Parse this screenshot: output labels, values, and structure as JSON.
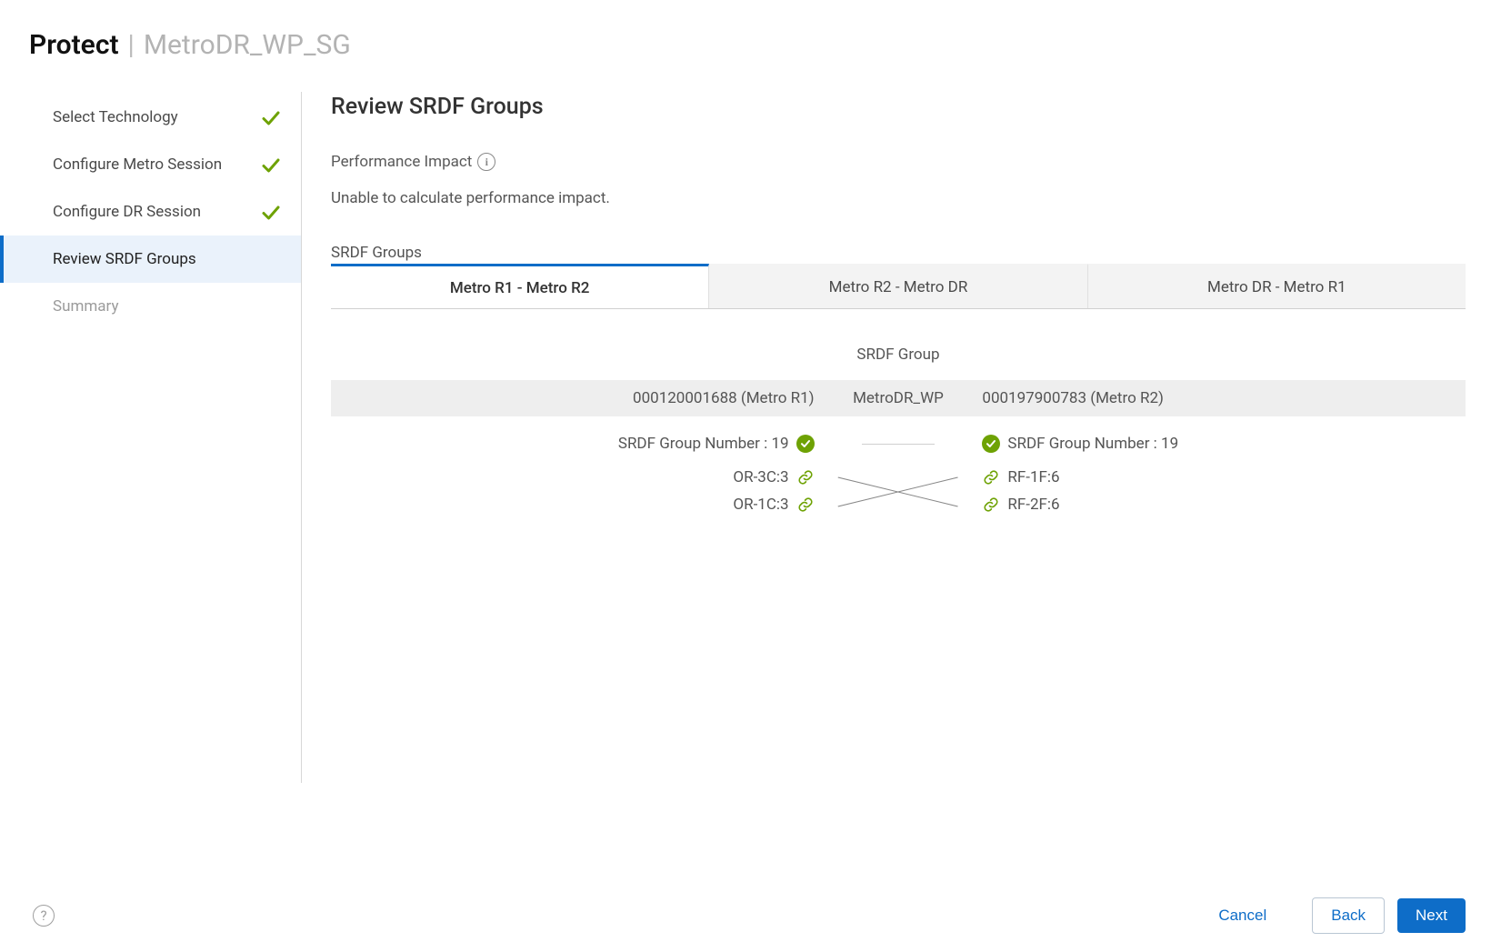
{
  "title": {
    "main": "Protect",
    "sub": "MetroDR_WP_SG"
  },
  "steps": [
    {
      "label": "Select Technology",
      "status": "completed"
    },
    {
      "label": "Configure Metro Session",
      "status": "completed"
    },
    {
      "label": "Configure DR Session",
      "status": "completed"
    },
    {
      "label": "Review SRDF Groups",
      "status": "active"
    },
    {
      "label": "Summary",
      "status": "pending"
    }
  ],
  "main": {
    "heading": "Review SRDF Groups",
    "perf_label": "Performance Impact",
    "perf_msg": "Unable to calculate performance impact.",
    "groups_label": "SRDF Groups"
  },
  "tabs": [
    {
      "label": "Metro R1 - Metro R2",
      "active": true
    },
    {
      "label": "Metro R2 - Metro DR",
      "active": false
    },
    {
      "label": "Metro DR - Metro R1",
      "active": false
    }
  ],
  "group": {
    "title": "SRDF Group",
    "left_header": "000120001688 (Metro R1)",
    "mid_header": "MetroDR_WP",
    "right_header": "000197900783 (Metro R2)",
    "left_num": "SRDF Group Number : 19",
    "right_num": "SRDF Group Number : 19",
    "left_ports": [
      "OR-3C:3",
      "OR-1C:3"
    ],
    "right_ports": [
      "RF-1F:6",
      "RF-2F:6"
    ]
  },
  "footer": {
    "cancel": "Cancel",
    "back": "Back",
    "next": "Next"
  },
  "colors": {
    "accent": "#0e6dc8",
    "green": "#6ea204"
  }
}
